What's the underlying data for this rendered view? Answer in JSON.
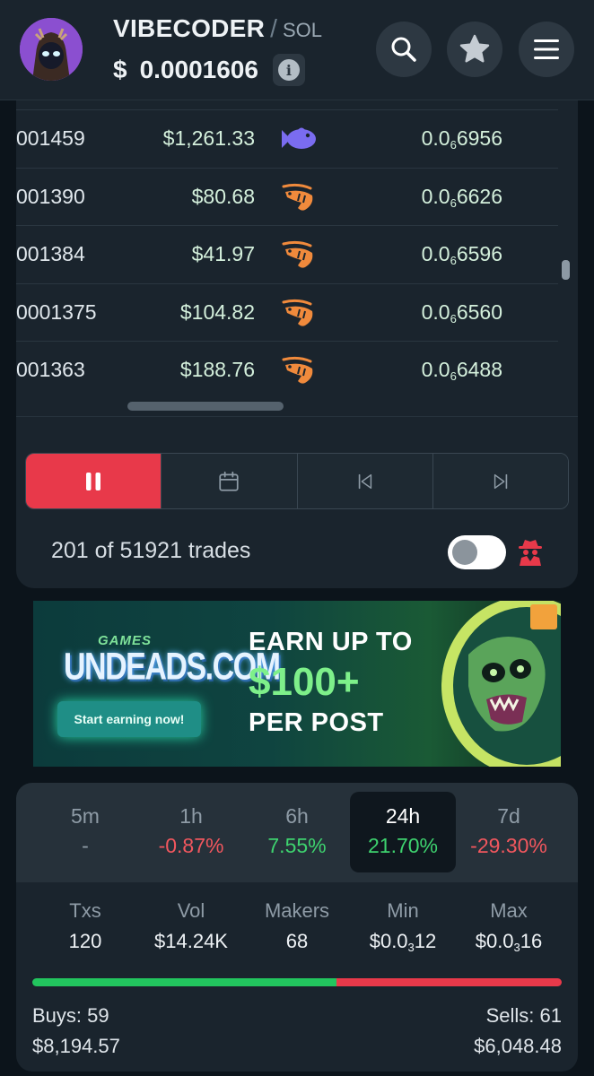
{
  "header": {
    "token_name": "VIBECODER",
    "separator": "/",
    "chain": "SOL",
    "price_symbol": "$",
    "price": "0.0001606",
    "info_icon": "info-icon",
    "buttons": [
      "search-icon",
      "star-icon",
      "menu-icon"
    ]
  },
  "trades": {
    "rows": [
      {
        "price": "001459",
        "usd": "$1,261.33",
        "trader_type": "fish-icon",
        "amount_prefix": "0.0",
        "amount_sub": "6",
        "amount_suffix": "6956"
      },
      {
        "price": "001390",
        "usd": "$80.68",
        "trader_type": "shrimp-icon",
        "amount_prefix": "0.0",
        "amount_sub": "6",
        "amount_suffix": "6626"
      },
      {
        "price": "001384",
        "usd": "$41.97",
        "trader_type": "shrimp-icon",
        "amount_prefix": "0.0",
        "amount_sub": "6",
        "amount_suffix": "6596"
      },
      {
        "price": "0001375",
        "usd": "$104.82",
        "trader_type": "shrimp-icon",
        "amount_prefix": "0.0",
        "amount_sub": "6",
        "amount_suffix": "6560"
      },
      {
        "price": "001363",
        "usd": "$188.76",
        "trader_type": "shrimp-icon",
        "amount_prefix": "0.0",
        "amount_sub": "6",
        "amount_suffix": "6488"
      }
    ],
    "controls": [
      "pause-icon",
      "calendar-icon",
      "skip-back-icon",
      "skip-forward-icon"
    ],
    "active_control": "pause-icon",
    "count_text": "201 of 51921 trades",
    "toggle_on": false,
    "colors": {
      "pause_active": "#e8394a",
      "shrimp": "#f08a3c",
      "fish": "#7a6cf0"
    }
  },
  "banner": {
    "games_label": "GAMES",
    "brand": "UNDEADS.COM",
    "cta": "Start earning now!",
    "headline_1": "EARN UP TO",
    "headline_2": "$100+",
    "headline_3": "PER POST"
  },
  "stats": {
    "timeframes": [
      {
        "label": "5m",
        "value": "-",
        "trend": "none"
      },
      {
        "label": "1h",
        "value": "-0.87%",
        "trend": "neg"
      },
      {
        "label": "6h",
        "value": "7.55%",
        "trend": "pos"
      },
      {
        "label": "24h",
        "value": "21.70%",
        "trend": "pos"
      },
      {
        "label": "7d",
        "value": "-29.30%",
        "trend": "neg"
      }
    ],
    "active_timeframe": "24h",
    "metrics": {
      "txs": {
        "label": "Txs",
        "value": "120"
      },
      "vol": {
        "label": "Vol",
        "value": "$14.24K"
      },
      "makers": {
        "label": "Makers",
        "value": "68"
      },
      "min": {
        "label": "Min",
        "prefix": "$0.0",
        "sub": "3",
        "suffix": "12"
      },
      "max": {
        "label": "Max",
        "prefix": "$0.0",
        "sub": "3",
        "suffix": "16"
      }
    },
    "buys_label": "Buys: 59",
    "buys_usd": "$8,194.57",
    "sells_label": "Sells: 61",
    "sells_usd": "$6,048.48",
    "buy_ratio": 0.575,
    "colors": {
      "buy": "#22c55e",
      "sell": "#e8394a"
    }
  }
}
